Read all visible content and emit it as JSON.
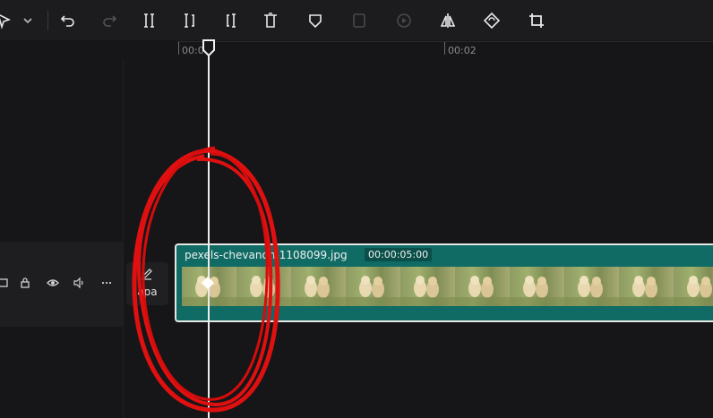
{
  "toolbar": {
    "icons": [
      "select-cursor-icon",
      "dropdown-chevron-icon",
      "undo-icon",
      "redo-icon",
      "split-icon",
      "split-left-icon",
      "split-right-icon",
      "delete-icon",
      "mark-icon",
      "freeze-frame-icon",
      "reverse-icon",
      "mirror-icon",
      "rotate-icon",
      "crop-icon"
    ]
  },
  "ruler": {
    "labels": [
      "00:0",
      "00:02"
    ]
  },
  "track": {
    "cover_label": "apa"
  },
  "clip": {
    "name": "pexels-chevanon-1108099.jpg",
    "duration": "00:00:05:00"
  },
  "colors": {
    "clip_fill": "#0f6b64",
    "playhead": "#ececec",
    "annotation": "#e01010",
    "background": "#161618"
  }
}
